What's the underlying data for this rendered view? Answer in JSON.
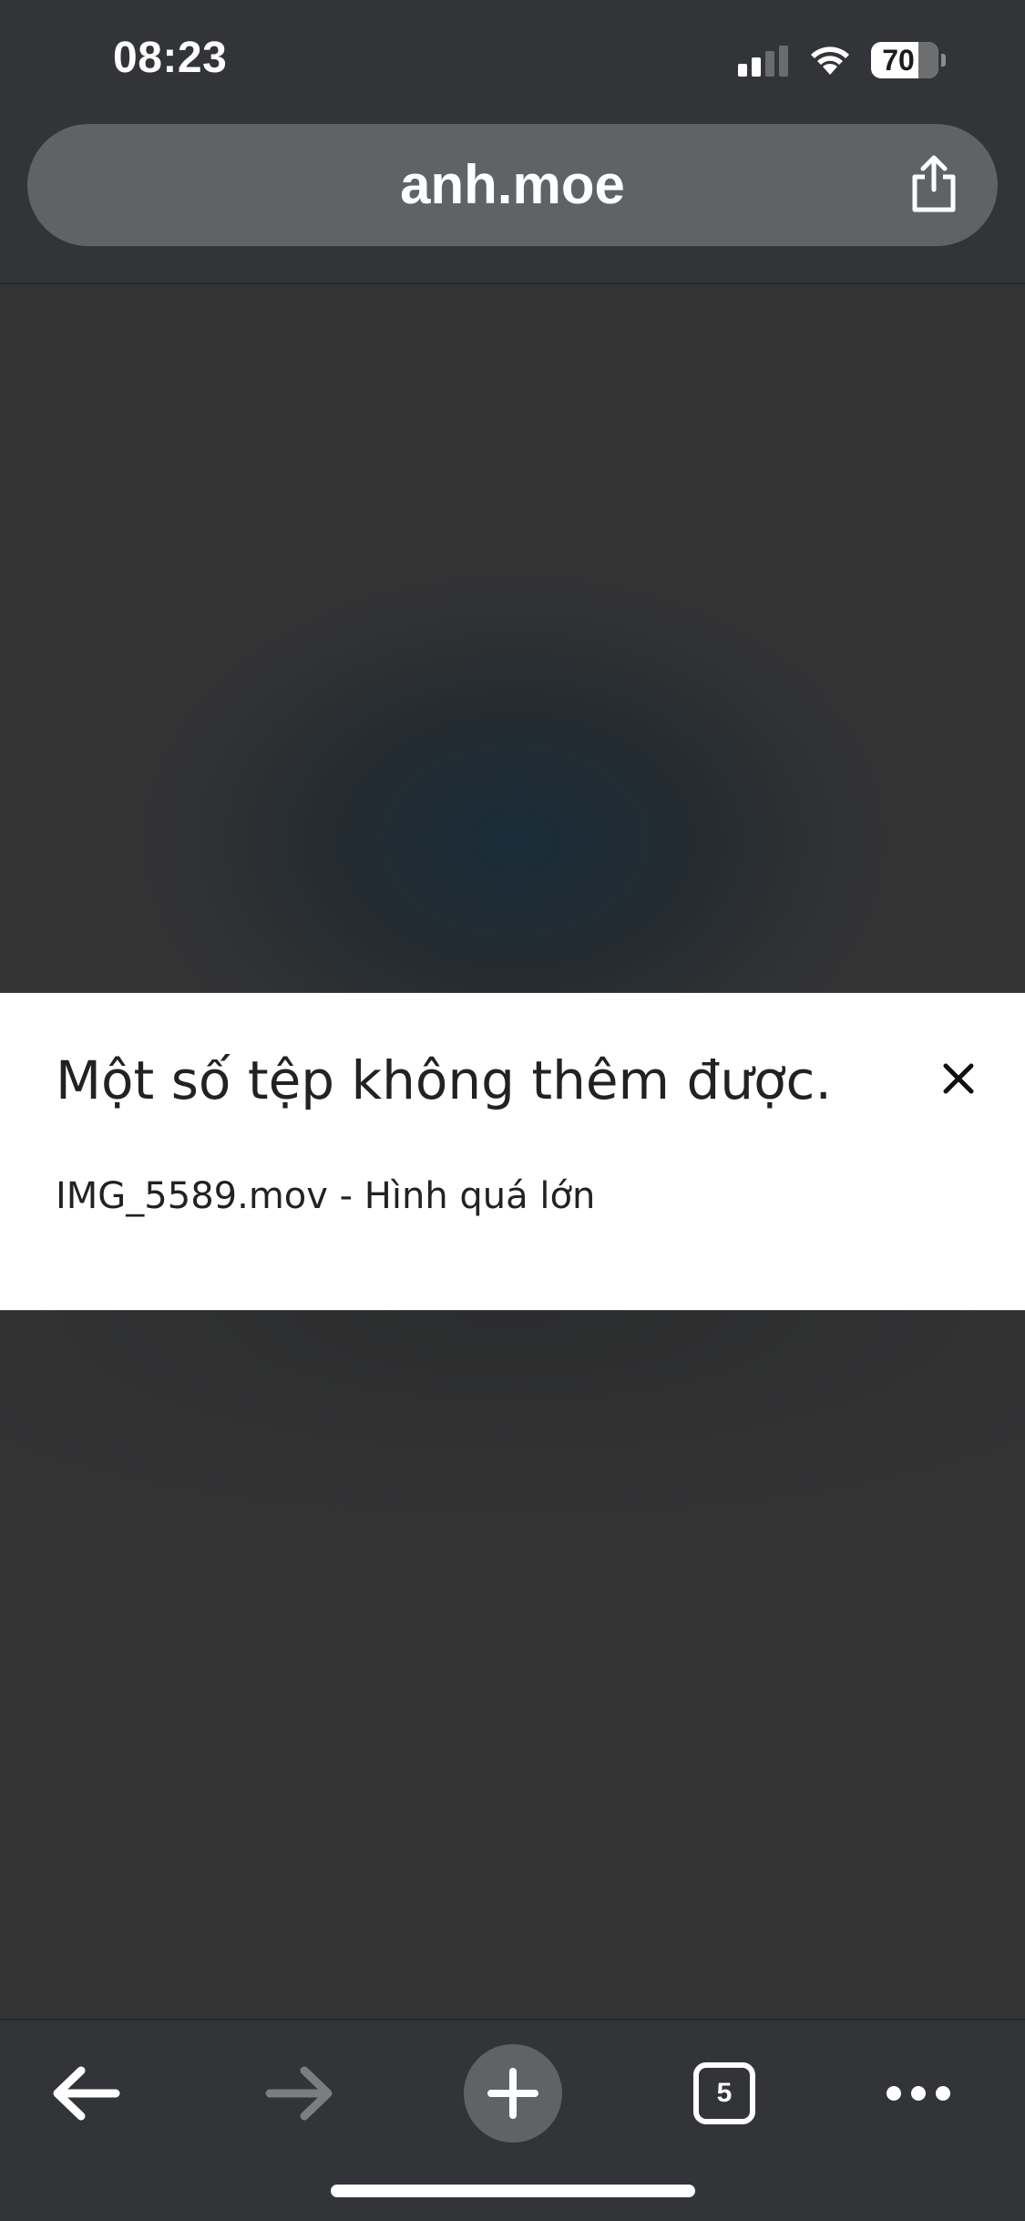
{
  "status_bar": {
    "time": "08:23",
    "battery_level": "70",
    "battery_fraction": 0.7,
    "signal_icon": "cellular-signal-icon",
    "wifi_icon": "wifi-icon"
  },
  "browser": {
    "url": "anh.moe",
    "share_icon": "share-icon"
  },
  "error_banner": {
    "title": "Một số tệp không thêm được.",
    "detail": "IMG_5589.mov - Hình quá lớn",
    "close_icon": "close-icon"
  },
  "toolbar": {
    "back_icon": "back-arrow-icon",
    "forward_icon": "forward-arrow-icon",
    "new_tab_icon": "plus-icon",
    "tab_count": "5",
    "menu_icon": "more-dots-icon"
  },
  "colors": {
    "chrome_background": "#323437",
    "url_bar": "#5f6366",
    "banner_background": "#ffffff",
    "text_light": "#ffffff",
    "text_dark": "#222222",
    "disabled_icon": "#7b7d80"
  }
}
